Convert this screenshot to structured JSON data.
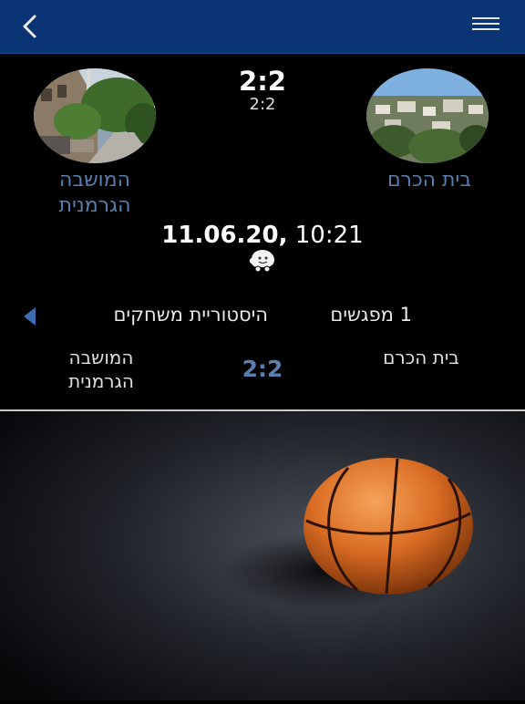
{
  "header": {
    "back_icon": "chevron-left-icon",
    "menu_icon": "hamburger-menu-icon",
    "bar_color": "#0a3474"
  },
  "match": {
    "home_team": "בית הכרם",
    "away_team": "המושבה הגרמנית",
    "score": "2:2",
    "score_secondary": "2:2",
    "date": "11.06.20",
    "separator": ",",
    "time": "10:21",
    "navigation_icon": "waze-icon"
  },
  "tabs": {
    "meetings": "1 מפגשים",
    "history": "היסטוריית משחקים",
    "arrow_icon": "triangle-left-icon"
  },
  "history_row": {
    "home_team": "בית הכרם",
    "away_team": "המושבה הגרמנית",
    "score": "2:2"
  },
  "colors": {
    "accent": "#5a7faf",
    "background": "#000000"
  }
}
